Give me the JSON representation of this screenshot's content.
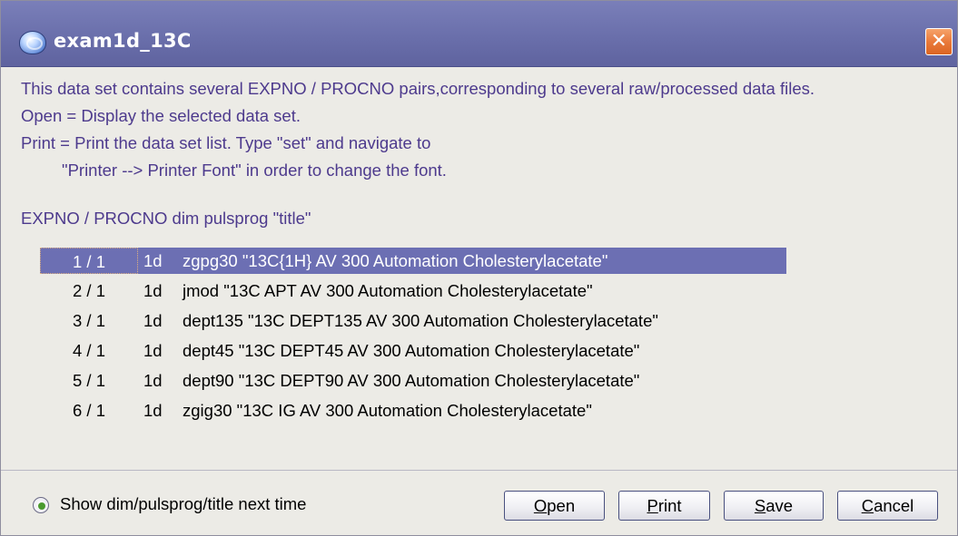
{
  "window": {
    "title": "exam1d_13C",
    "close_glyph": "✕",
    "icon": "bruker-app-icon"
  },
  "info": {
    "line1": "This data set contains several EXPNO / PROCNO pairs,corresponding to several raw/processed data files.",
    "line2": "Open = Display the selected data set.",
    "line3": "Print = Print the data set list. Type \"set\" and navigate to",
    "line4": "\"Printer --> Printer Font\" in order to change the font."
  },
  "list": {
    "header": "EXPNO / PROCNO   dim pulsprog \"title\"",
    "selected_index": 0,
    "rows": [
      {
        "expno": "1 / 1",
        "dim": "1d",
        "desc": "zgpg30   \"13C{1H}    AV 300 Automation    Cholesterylacetate\""
      },
      {
        "expno": "2 / 1",
        "dim": "1d",
        "desc": "jmod   \"13C APT    AV 300 Automation    Cholesterylacetate\""
      },
      {
        "expno": "3 / 1",
        "dim": "1d",
        "desc": "dept135   \"13C DEPT135    AV 300 Automation    Cholesterylacetate\""
      },
      {
        "expno": "4 / 1",
        "dim": "1d",
        "desc": "dept45   \"13C DEPT45      AV 300 Automation    Cholesterylacetate\""
      },
      {
        "expno": "5 / 1",
        "dim": "1d",
        "desc": "dept90   \"13C DEPT90    AV 300 Automation    Cholesterylacetate\""
      },
      {
        "expno": "6 / 1",
        "dim": "1d",
        "desc": "zgig30   \"13C IG    AV 300 Automation    Cholesterylacetate\""
      }
    ]
  },
  "footer": {
    "show_option_label": "Show dim/pulsprog/title next time",
    "show_option_checked": true,
    "buttons": {
      "open": {
        "first": "O",
        "rest": "pen"
      },
      "print": {
        "first": "P",
        "rest": "rint"
      },
      "save": {
        "first": "S",
        "rest": "ave"
      },
      "cancel": {
        "first": "C",
        "rest": "ancel"
      }
    }
  },
  "colors": {
    "titlebar": "#6a6fab",
    "selection": "#6c6fb3",
    "info_text": "#4d3a8d",
    "close_button": "#ea7a3b",
    "radio_dot": "#4a9a2e"
  }
}
